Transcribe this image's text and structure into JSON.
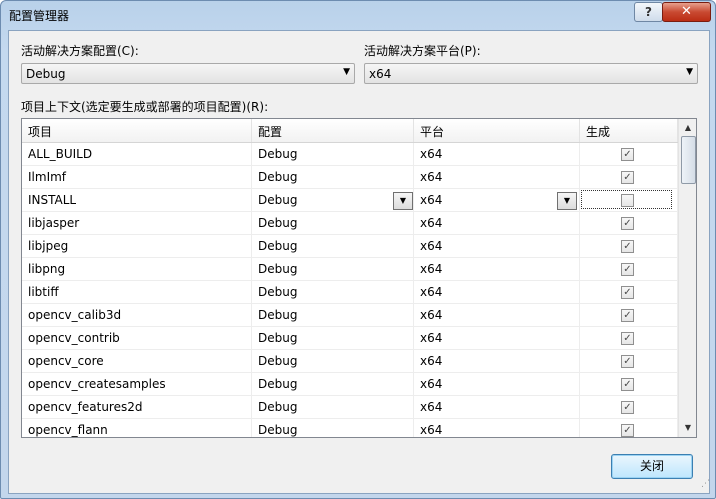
{
  "window": {
    "title": "配置管理器",
    "help_label": "?",
    "close_label": "✕"
  },
  "active_config": {
    "label": "活动解决方案配置(C):",
    "value": "Debug"
  },
  "active_platform": {
    "label": "活动解决方案平台(P):",
    "value": "x64"
  },
  "project_contexts": {
    "label": "项目上下文(选定要生成或部署的项目配置)(R):",
    "columns": [
      "项目",
      "配置",
      "平台",
      "生成"
    ],
    "rows": [
      {
        "project": "ALL_BUILD",
        "config": "Debug",
        "platform": "x64",
        "build": true
      },
      {
        "project": "IlmImf",
        "config": "Debug",
        "platform": "x64",
        "build": true
      },
      {
        "project": "INSTALL",
        "config": "Debug",
        "platform": "x64",
        "build": false,
        "selected": true
      },
      {
        "project": "libjasper",
        "config": "Debug",
        "platform": "x64",
        "build": true
      },
      {
        "project": "libjpeg",
        "config": "Debug",
        "platform": "x64",
        "build": true
      },
      {
        "project": "libpng",
        "config": "Debug",
        "platform": "x64",
        "build": true
      },
      {
        "project": "libtiff",
        "config": "Debug",
        "platform": "x64",
        "build": true
      },
      {
        "project": "opencv_calib3d",
        "config": "Debug",
        "platform": "x64",
        "build": true
      },
      {
        "project": "opencv_contrib",
        "config": "Debug",
        "platform": "x64",
        "build": true
      },
      {
        "project": "opencv_core",
        "config": "Debug",
        "platform": "x64",
        "build": true
      },
      {
        "project": "opencv_createsamples",
        "config": "Debug",
        "platform": "x64",
        "build": true
      },
      {
        "project": "opencv_features2d",
        "config": "Debug",
        "platform": "x64",
        "build": true
      },
      {
        "project": "opencv_flann",
        "config": "Debug",
        "platform": "x64",
        "build": true
      }
    ]
  },
  "buttons": {
    "close": "关闭"
  },
  "icons": {
    "dropdown": "chevron-down-icon",
    "check": "checkmark-icon",
    "scroll_up": "scroll-up-arrow-icon",
    "scroll_down": "scroll-down-arrow-icon"
  }
}
